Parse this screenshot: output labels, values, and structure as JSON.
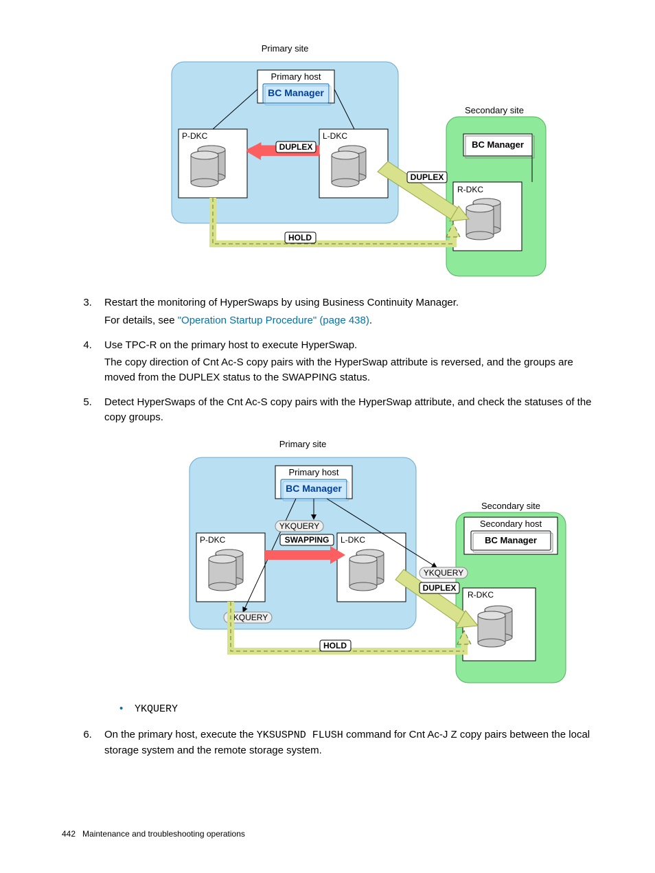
{
  "diagram1": {
    "primarySite": "Primary site",
    "primaryHost": "Primary host",
    "bcManager": "BC Manager",
    "secondarySite": "Secondary site",
    "secondaryBcManager": "BC Manager",
    "pdkc": "P-DKC",
    "ldkc": "L-DKC",
    "rdkc": "R-DKC",
    "duplex1": "DUPLEX",
    "duplex2": "DUPLEX",
    "hold": "HOLD"
  },
  "step3": {
    "line1": "Restart the monitoring of HyperSwaps by using Business Continuity Manager.",
    "line2a": "For details, see ",
    "linkText": "\"Operation Startup Procedure\" (page 438)",
    "line2b": "."
  },
  "step4": {
    "line1": "Use TPC-R on the primary host to execute HyperSwap.",
    "line2": "The copy direction of Cnt Ac-S copy pairs with the HyperSwap attribute is reversed, and the groups are moved from the DUPLEX status to the SWAPPING status."
  },
  "step5": {
    "line1": "Detect HyperSwaps of the Cnt Ac-S copy pairs with the HyperSwap attribute, and check the statuses of the copy groups."
  },
  "diagram2": {
    "primarySite": "Primary site",
    "primaryHost": "Primary host",
    "bcManager": "BC Manager",
    "secondarySite": "Secondary site",
    "secondaryHost": "Secondary host",
    "secondaryBcManager": "BC Manager",
    "pdkc": "P-DKC",
    "ldkc": "L-DKC",
    "rdkc": "R-DKC",
    "ykquery1": "YKQUERY",
    "ykquery2": "YKQUERY",
    "ykquery3": "YKQUERY",
    "swapping": "SWAPPING",
    "duplex": "DUPLEX",
    "hold": "HOLD"
  },
  "bullet1": "YKQUERY",
  "step6": {
    "before": "On the primary host, execute the ",
    "mono": "YKSUSPND FLUSH",
    "after": " command for Cnt Ac-J Z copy pairs between the local storage system and the remote storage system."
  },
  "footer": {
    "pageNum": "442",
    "title": "Maintenance and troubleshooting operations"
  }
}
